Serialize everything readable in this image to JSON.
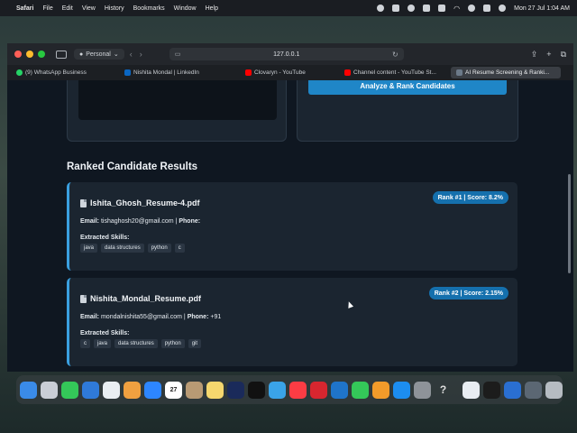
{
  "menubar": {
    "app_name": "Safari",
    "items": [
      "File",
      "Edit",
      "View",
      "History",
      "Bookmarks",
      "Window",
      "Help"
    ],
    "datetime": "Mon 27 Jul  1:04 AM"
  },
  "toolbar": {
    "profile_label": "Personal",
    "url": "127.0.0.1"
  },
  "tabs": [
    {
      "label": "(9) WhatsApp Business",
      "color": "#25d366",
      "active": false
    },
    {
      "label": "Nishita Mondal | LinkedIn",
      "color": "#0a66c2",
      "active": false
    },
    {
      "label": "Clovaryn - YouTube",
      "color": "#ff0000",
      "active": false
    },
    {
      "label": "Channel content - YouTube St...",
      "color": "#ff0000",
      "active": false
    },
    {
      "label": "AI Resume Screening & Ranki...",
      "color": "#6c7a89",
      "active": true
    }
  ],
  "page": {
    "analyze_button": "Analyze & Rank Candidates",
    "section_title": "Ranked Candidate Results",
    "email_label": "Email:",
    "phone_label": "Phone:",
    "skills_label": "Extracted Skills:",
    "candidates": [
      {
        "file_name": "Ishita_Ghosh_Resume-4.pdf",
        "rank_badge": "Rank #1 | Score: 8.2%",
        "email": "tishaghosh20@gmail.com",
        "separator": "|",
        "phone": "",
        "skills": [
          "java",
          "data structures",
          "python",
          "c"
        ]
      },
      {
        "file_name": "Nishita_Mondal_Resume.pdf",
        "rank_badge": "Rank #2 | Score: 2.15%",
        "email": "mondalnishita55@gmail.com",
        "separator": "|",
        "phone": "+91",
        "skills": [
          "c",
          "java",
          "data structures",
          "python",
          "git"
        ]
      }
    ]
  },
  "colors": {
    "accent": "#1f86c7",
    "card_border": "#3aa0e0",
    "badge": "#1570ad",
    "page_bg": "#0f1721",
    "card_bg": "#1b2530"
  },
  "dock": {
    "calendar_day": "27"
  }
}
